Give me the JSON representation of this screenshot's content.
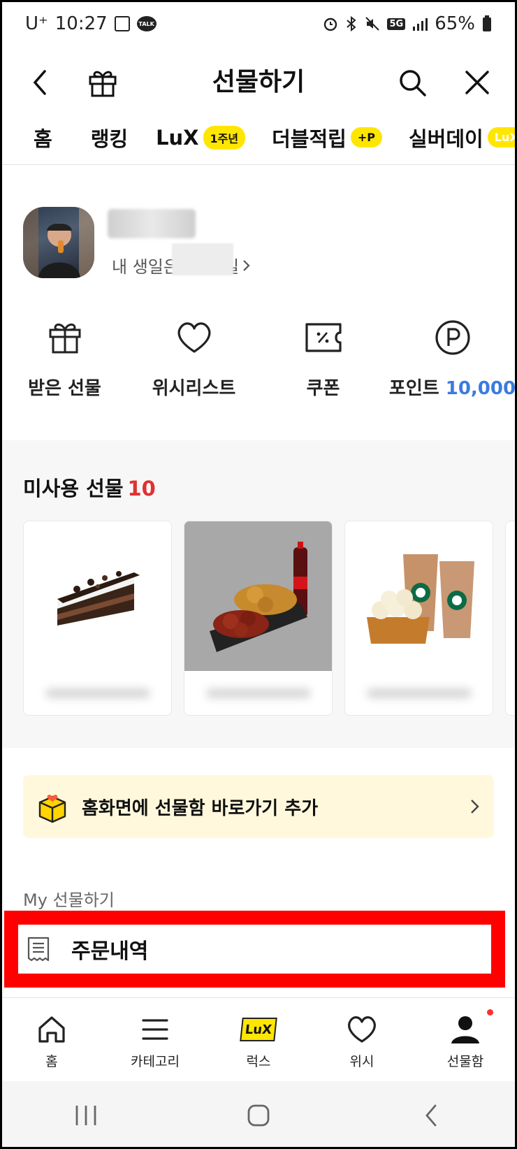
{
  "status_bar": {
    "carrier": "U⁺",
    "time": "10:27",
    "talk_badge": "TALK",
    "network": "5G",
    "battery": "65%",
    "icons": [
      "image-icon",
      "kakaotalk-icon",
      "alarm-icon",
      "bluetooth-icon",
      "mute-icon",
      "signal-icon",
      "battery-icon"
    ]
  },
  "header": {
    "title": "선물하기"
  },
  "tabs": [
    {
      "label": "홈"
    },
    {
      "label": "랭킹"
    },
    {
      "label": "LuX",
      "badge": "1주년"
    },
    {
      "label": "더블적립",
      "badge": "+P"
    },
    {
      "label": "실버데이",
      "badge": "LuX"
    }
  ],
  "profile": {
    "birthday_text": "내 생일은",
    "birthday_suffix": "일"
  },
  "quick_menu": [
    {
      "label": "받은 선물",
      "icon": "gift-icon"
    },
    {
      "label": "위시리스트",
      "icon": "heart-icon"
    },
    {
      "label": "쿠폰",
      "icon": "coupon-icon"
    },
    {
      "label": "포인트",
      "value": "10,000",
      "icon": "point-icon"
    }
  ],
  "unused": {
    "title": "미사용 선물",
    "count": "10"
  },
  "banner": {
    "text": "홈화면에 선물함 바로가기 추가"
  },
  "my_section": {
    "title": "My 선물하기",
    "order_history": "주문내역"
  },
  "bottom_nav": [
    {
      "label": "홈",
      "icon": "home-icon"
    },
    {
      "label": "카테고리",
      "icon": "menu-icon"
    },
    {
      "label": "럭스",
      "icon": "lux-icon",
      "icon_text": "LuX"
    },
    {
      "label": "위시",
      "icon": "heart-icon"
    },
    {
      "label": "선물함",
      "icon": "person-icon"
    }
  ],
  "colors": {
    "accent_yellow": "#ffe600",
    "point_blue": "#3b7be0",
    "count_red": "#e03131",
    "highlight_red": "#ff0000"
  }
}
